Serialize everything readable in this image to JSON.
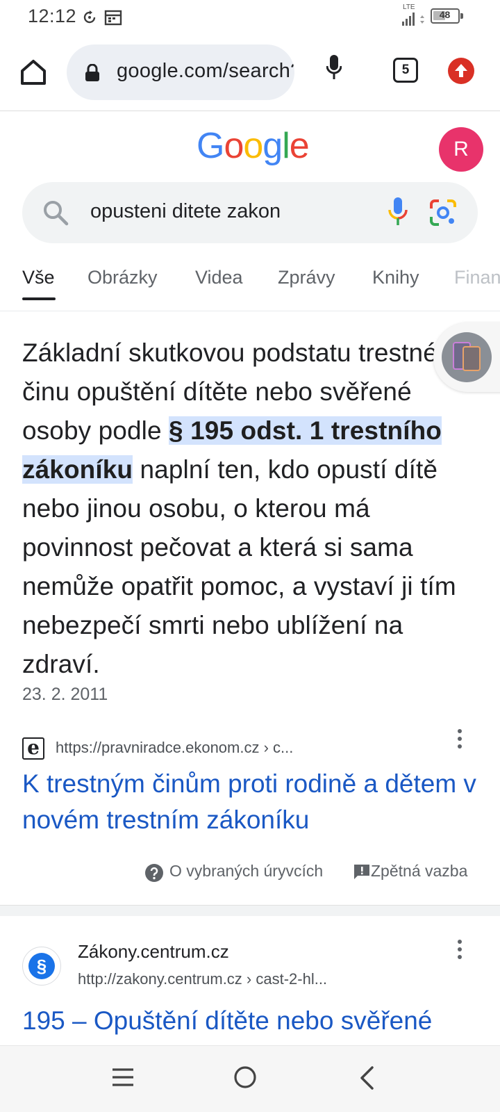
{
  "status_bar": {
    "time": "12:12",
    "network": "LTE",
    "battery": "48"
  },
  "browser": {
    "url": "google.com/search?q=opusteni",
    "tab_count": "5"
  },
  "google": {
    "logo": [
      "G",
      "o",
      "o",
      "g",
      "l",
      "e"
    ],
    "avatar_letter": "R",
    "query": "opusteni ditete zakon",
    "tabs": [
      "Vše",
      "Obrázky",
      "Videa",
      "Zprávy",
      "Knihy",
      "Finance"
    ]
  },
  "snippet": {
    "text_before": "Základní skutkovou podstatu trestného činu opuštění dítěte nebo svěřené osoby podle ",
    "highlight": "§ 195 odst. 1 trestního zákoníku",
    "text_after": " naplní ten, kdo opustí dítě nebo jinou osobu, o kterou má povinnost pečovat a která si sama nemůže opatřit pomoc, a vystaví ji tím nebezpečí smrti nebo ublížení na zdraví.",
    "date": "23. 2. 2011",
    "source_favicon": "e",
    "source_url": "https://pravniradce.ekonom.cz › c...",
    "source_title": "K trestným činům proti rodině a dětem v novém trestním zákoníku",
    "about_label": "O vybraných úryvcích",
    "feedback_label": "Zpětná vazba"
  },
  "result2": {
    "favicon": "§",
    "site_name": "Zákony.centrum.cz",
    "url": "http://zakony.centrum.cz › cast-2-hl...",
    "title": "195 – Opuštění dítěte nebo svěřené"
  },
  "colors": {
    "link": "#1a58c4",
    "highlight": "#d3e3fd",
    "avatar": "#e8336b",
    "update": "#d93025",
    "google_blue": "#4285F4",
    "google_red": "#EA4335",
    "google_yellow": "#FBBC05",
    "google_green": "#34A853"
  }
}
